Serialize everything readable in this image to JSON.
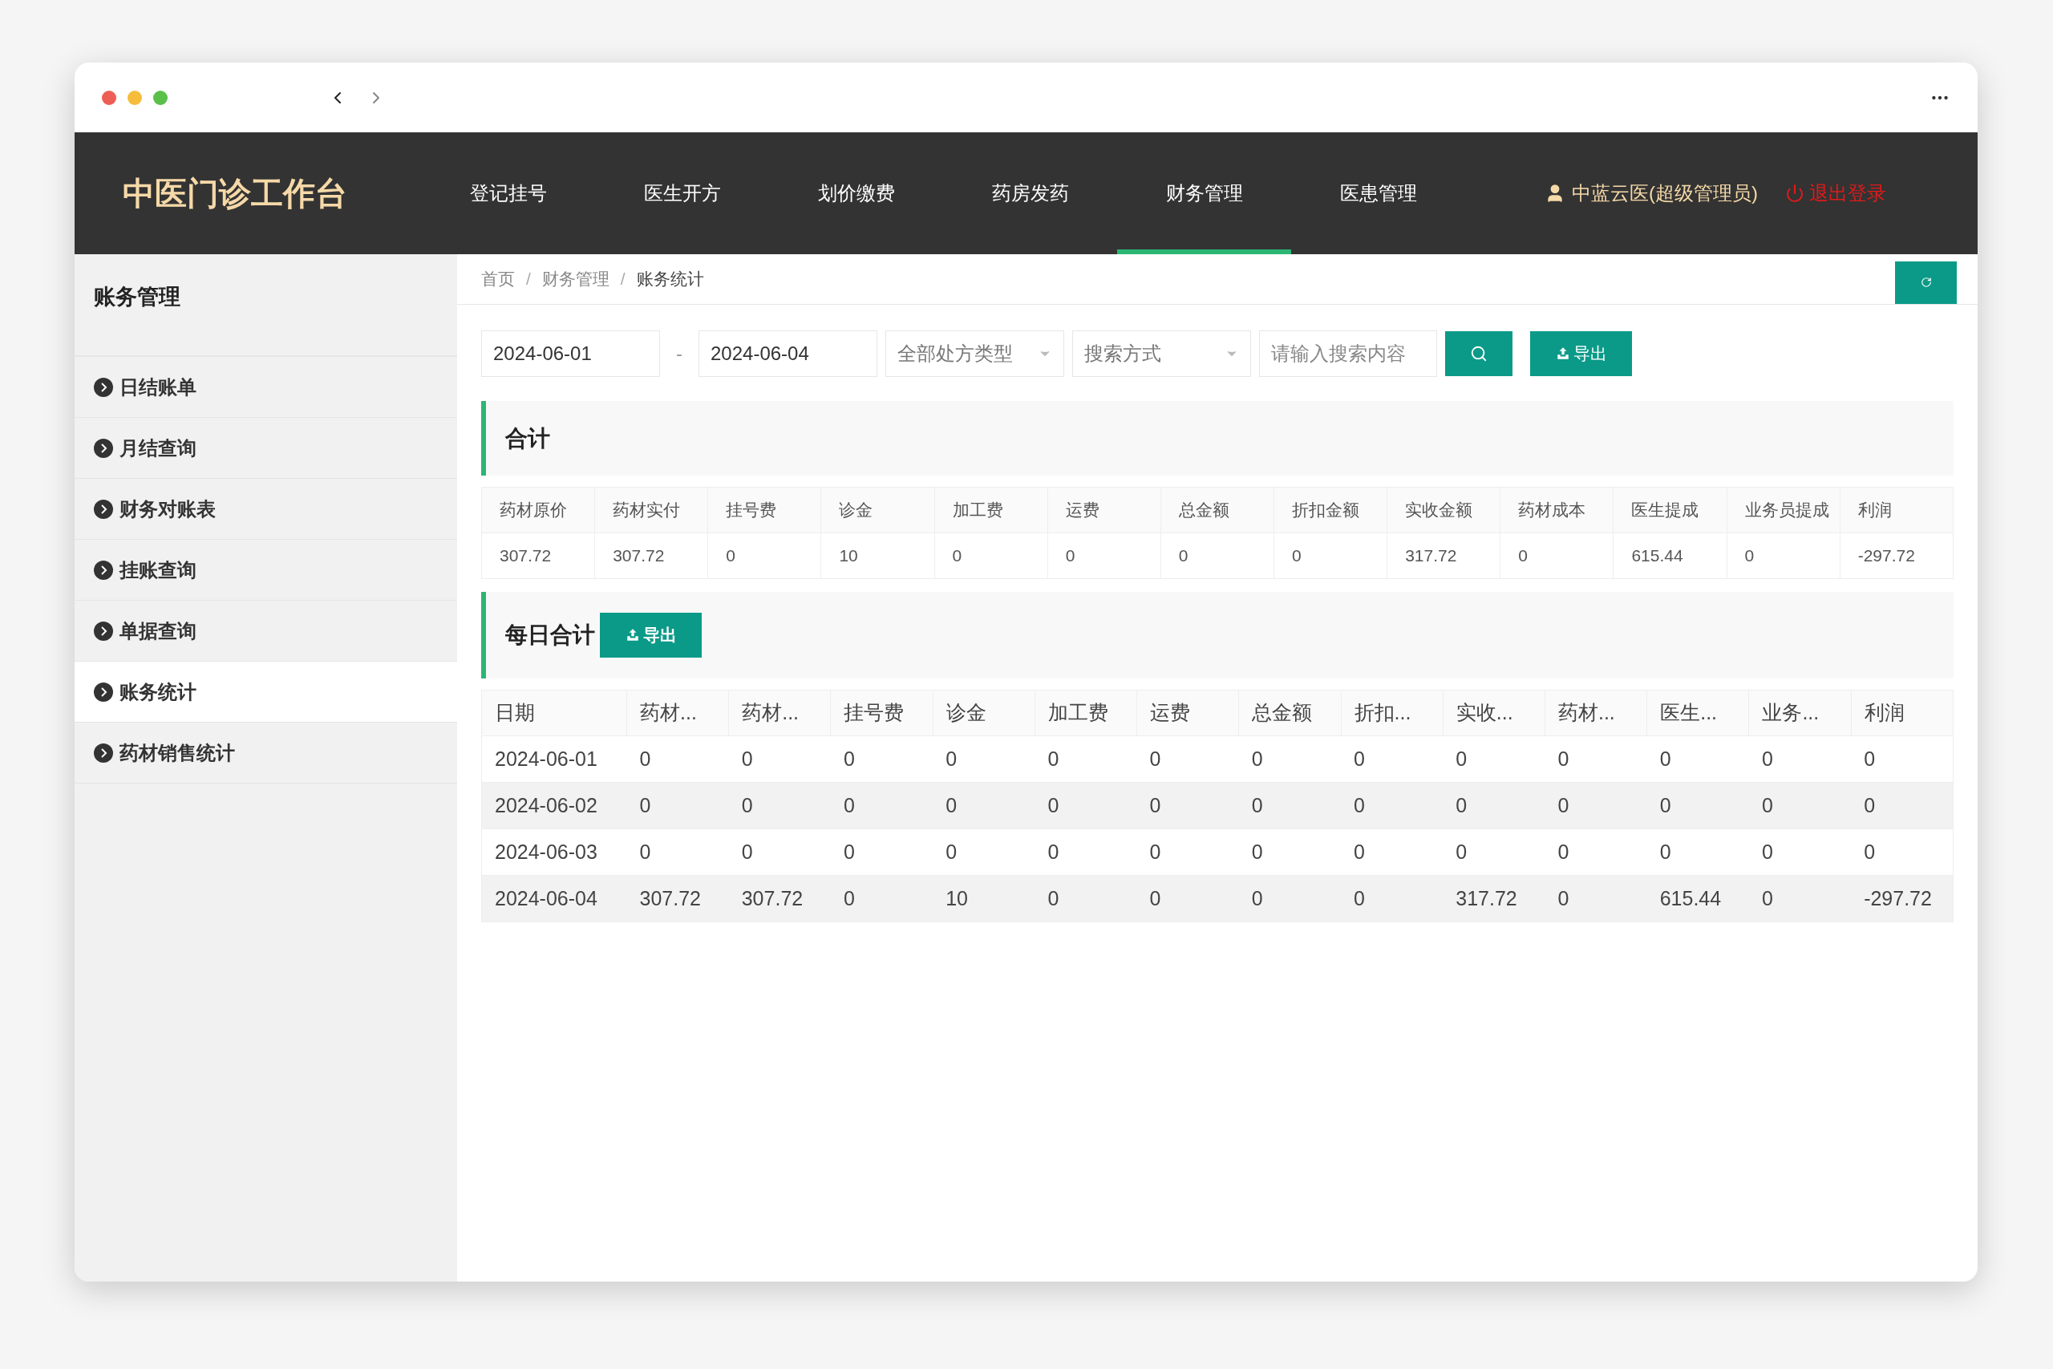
{
  "header": {
    "logo": "中医门诊工作台",
    "nav": [
      {
        "label": "登记挂号",
        "selected": false
      },
      {
        "label": "医生开方",
        "selected": false
      },
      {
        "label": "划价缴费",
        "selected": false
      },
      {
        "label": "药房发药",
        "selected": false
      },
      {
        "label": "财务管理",
        "selected": true
      },
      {
        "label": "医患管理",
        "selected": false
      }
    ],
    "user": "中蓝云医(超级管理员)",
    "logout": "退出登录"
  },
  "sidebar": {
    "title": "账务管理",
    "items": [
      {
        "label": "日结账单",
        "selected": false
      },
      {
        "label": "月结查询",
        "selected": false
      },
      {
        "label": "财务对账表",
        "selected": false
      },
      {
        "label": "挂账查询",
        "selected": false
      },
      {
        "label": "单据查询",
        "selected": false
      },
      {
        "label": "账务统计",
        "selected": true
      },
      {
        "label": "药材销售统计",
        "selected": false
      }
    ]
  },
  "breadcrumb": [
    "首页",
    "财务管理",
    "账务统计"
  ],
  "breadcrumb_separator": "/",
  "filters": {
    "start_date": "2024-06-01",
    "separator": "-",
    "end_date": "2024-06-04",
    "type_select": "全部处方类型",
    "mode_select": "搜索方式",
    "search": {
      "placeholder": "请输入搜索内容"
    },
    "export": "导出"
  },
  "summary": {
    "title": "合计",
    "columns": [
      "药材原价",
      "药材实付",
      "挂号费",
      "诊金",
      "加工费",
      "运费",
      "总金额",
      "折扣金额",
      "实收金额",
      "药材成本",
      "医生提成",
      "业务员提成",
      "利润"
    ],
    "row": [
      "307.72",
      "307.72",
      "0",
      "10",
      "0",
      "0",
      "0",
      "0",
      "317.72",
      "0",
      "615.44",
      "0",
      "-297.72"
    ]
  },
  "daily": {
    "title": "每日合计",
    "export": "导出",
    "columns": [
      "日期",
      "药材...",
      "药材...",
      "挂号费",
      "诊金",
      "加工费",
      "运费",
      "总金额",
      "折扣...",
      "实收...",
      "药材...",
      "医生...",
      "业务...",
      "利润"
    ],
    "rows": [
      [
        "2024-06-01",
        "0",
        "0",
        "0",
        "0",
        "0",
        "0",
        "0",
        "0",
        "0",
        "0",
        "0",
        "0",
        "0"
      ],
      [
        "2024-06-02",
        "0",
        "0",
        "0",
        "0",
        "0",
        "0",
        "0",
        "0",
        "0",
        "0",
        "0",
        "0",
        "0"
      ],
      [
        "2024-06-03",
        "0",
        "0",
        "0",
        "0",
        "0",
        "0",
        "0",
        "0",
        "0",
        "0",
        "0",
        "0",
        "0"
      ],
      [
        "2024-06-04",
        "307.72",
        "307.72",
        "0",
        "10",
        "0",
        "0",
        "0",
        "0",
        "317.72",
        "0",
        "615.44",
        "0",
        "-297.72"
      ]
    ]
  }
}
